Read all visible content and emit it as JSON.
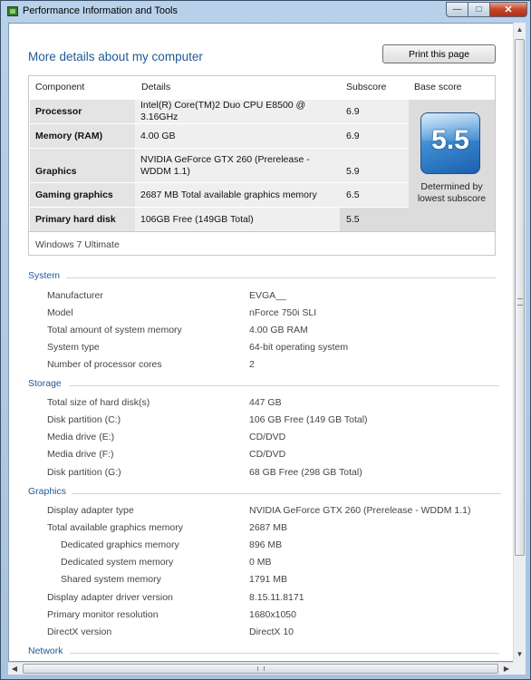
{
  "window": {
    "title": "Performance Information and Tools",
    "min_glyph": "—",
    "max_glyph": "□",
    "close_glyph": "✕"
  },
  "heading": "More details about my computer",
  "print_button": "Print this page",
  "rating": {
    "headers": {
      "component": "Component",
      "details": "Details",
      "subscore": "Subscore",
      "base_score": "Base score"
    },
    "rows": [
      {
        "component": "Processor",
        "details": "Intel(R) Core(TM)2 Duo CPU E8500 @ 3.16GHz",
        "subscore": "6.9"
      },
      {
        "component": "Memory (RAM)",
        "details": "4.00 GB",
        "subscore": "6.9"
      },
      {
        "component": "Graphics",
        "details": "NVIDIA GeForce GTX 260 (Prerelease - WDDM 1.1)",
        "subscore": "5.9"
      },
      {
        "component": "Gaming graphics",
        "details": "2687 MB Total available graphics memory",
        "subscore": "6.5"
      },
      {
        "component": "Primary hard disk",
        "details": "106GB Free (149GB Total)",
        "subscore": "5.5"
      }
    ],
    "base_score": "5.5",
    "base_caption": "Determined by lowest subscore",
    "edition": "Windows 7 Ultimate"
  },
  "sections": {
    "system": {
      "title": "System",
      "items": [
        {
          "key": "Manufacturer",
          "value": "EVGA__"
        },
        {
          "key": "Model",
          "value": "nForce 750i SLI"
        },
        {
          "key": "Total amount of system memory",
          "value": "4.00 GB RAM"
        },
        {
          "key": "System type",
          "value": "64-bit operating system"
        },
        {
          "key": "Number of processor cores",
          "value": "2"
        }
      ]
    },
    "storage": {
      "title": "Storage",
      "items": [
        {
          "key": "Total size of hard disk(s)",
          "value": "447 GB"
        },
        {
          "key": "Disk partition (C:)",
          "value": "106 GB Free (149 GB Total)"
        },
        {
          "key": "Media drive (E:)",
          "value": "CD/DVD"
        },
        {
          "key": "Media drive (F:)",
          "value": "CD/DVD"
        },
        {
          "key": "Disk partition (G:)",
          "value": "68 GB Free (298 GB Total)"
        }
      ]
    },
    "graphics": {
      "title": "Graphics",
      "items": [
        {
          "key": "Display adapter type",
          "value": "NVIDIA GeForce GTX 260 (Prerelease - WDDM 1.1)"
        },
        {
          "key": "Total available graphics memory",
          "value": "2687 MB"
        },
        {
          "key": "Dedicated graphics memory",
          "value": "896 MB"
        },
        {
          "key": "Dedicated system memory",
          "value": "0 MB"
        },
        {
          "key": "Shared system memory",
          "value": "1791 MB"
        },
        {
          "key": "Display adapter driver version",
          "value": "8.15.11.8171"
        },
        {
          "key": "Primary monitor resolution",
          "value": "1680x1050"
        },
        {
          "key": "DirectX version",
          "value": "DirectX 10"
        }
      ]
    },
    "network": {
      "title": "Network"
    }
  }
}
